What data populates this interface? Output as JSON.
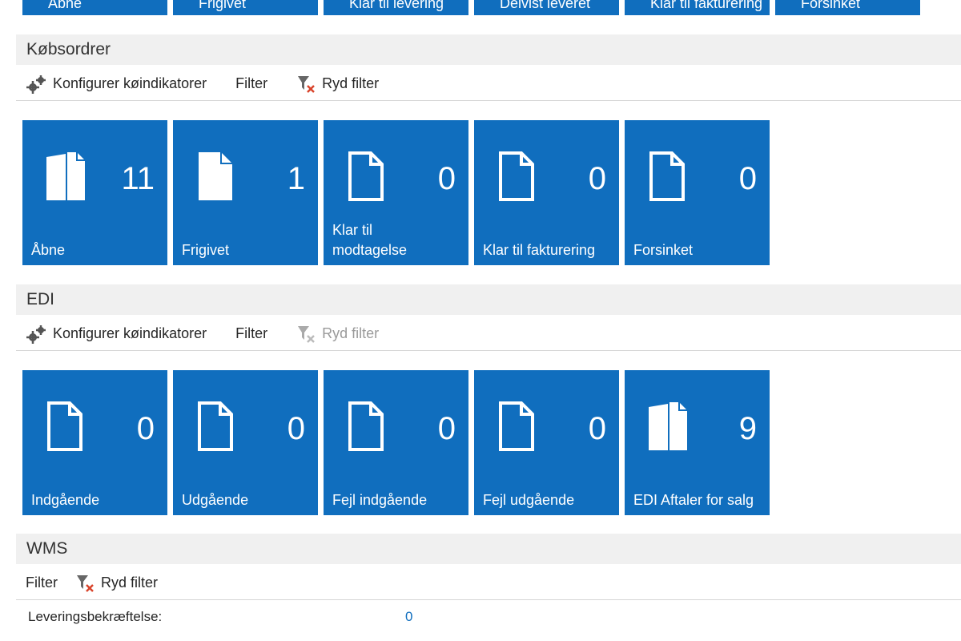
{
  "top_strip": [
    "Åbne",
    "Frigivet",
    "Klar til levering",
    "Delvist leveret",
    "Klar til fakturering",
    "Forsinket"
  ],
  "toolbar": {
    "configure_label": "Konfigurer køindikatorer",
    "filter_label": "Filter",
    "clear_filter_label": "Ryd filter"
  },
  "sections": {
    "purchase": {
      "title": "Købsordrer",
      "tiles": [
        {
          "label": "Åbne",
          "count": "11",
          "icon": "multi-doc-icon"
        },
        {
          "label": "Frigivet",
          "count": "1",
          "icon": "filled-doc-icon"
        },
        {
          "label": "Klar til modtagelse",
          "count": "0",
          "icon": "empty-doc-icon"
        },
        {
          "label": "Klar til fakturering",
          "count": "0",
          "icon": "empty-doc-icon"
        },
        {
          "label": "Forsinket",
          "count": "0",
          "icon": "empty-doc-icon"
        }
      ]
    },
    "edi": {
      "title": "EDI",
      "tiles": [
        {
          "label": "Indgående",
          "count": "0",
          "icon": "empty-doc-icon"
        },
        {
          "label": "Udgående",
          "count": "0",
          "icon": "empty-doc-icon"
        },
        {
          "label": "Fejl indgående",
          "count": "0",
          "icon": "empty-doc-icon"
        },
        {
          "label": "Fejl udgående",
          "count": "0",
          "icon": "empty-doc-icon"
        },
        {
          "label": "EDI Aftaler for salg",
          "count": "9",
          "icon": "multi-doc-icon"
        }
      ]
    },
    "wms": {
      "title": "WMS",
      "field_label": "Leveringsbekræftelse:",
      "field_value": "0"
    }
  },
  "colors": {
    "tile": "#106ebe",
    "header_bg": "#f0f0f0"
  }
}
